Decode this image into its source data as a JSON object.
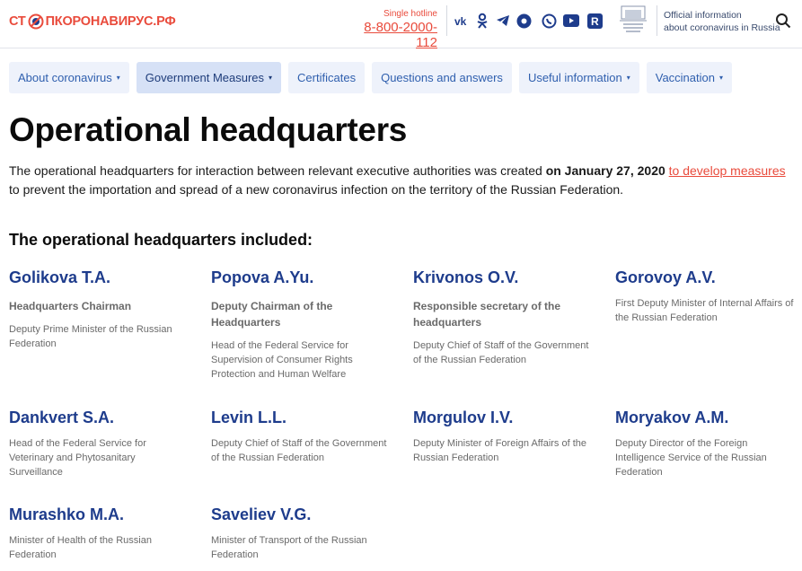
{
  "header": {
    "logo": {
      "part1": "СТ",
      "part2": "ПКОРОНАВИРУС.РФ"
    },
    "hotline_caption": "Single hotline",
    "hotline_number": "8-800-2000-112",
    "official_line1": "Official information",
    "official_line2": "about coronavirus in Russia",
    "socials": [
      "vk-icon",
      "odnoklassniki-icon",
      "telegram-icon",
      "ok-dot-icon",
      "viber-icon",
      "youtube-icon",
      "rutube-icon"
    ]
  },
  "nav": {
    "tabs": [
      {
        "label": "About coronavirus",
        "caret": "▾"
      },
      {
        "label": "Government Measures",
        "caret": "▾"
      },
      {
        "label": "Certificates",
        "caret": ""
      },
      {
        "label": "Questions and answers",
        "caret": ""
      },
      {
        "label": "Useful information",
        "caret": "▾"
      },
      {
        "label": "Vaccination",
        "caret": "▾"
      }
    ]
  },
  "page": {
    "title": "Operational headquarters",
    "intro_before": "The operational headquarters for interaction between relevant executive authorities was created ",
    "intro_date": "on January 27, 2020",
    "intro_link": "to develop measures",
    "intro_after": " to prevent the importation and spread of a new coronavirus infection on the territory of the Russian Federation.",
    "members_heading": "The operational headquarters included:"
  },
  "members": [
    {
      "name": "Golikova T.A.",
      "role": "Headquarters Chairman",
      "desc": "Deputy Prime Minister of the Russian Federation"
    },
    {
      "name": "Popova A.Yu.",
      "role": "Deputy Chairman of the Headquarters",
      "desc": "Head of the Federal Service for Supervision of Consumer Rights Protection and Human Welfare"
    },
    {
      "name": "Krivonos O.V.",
      "role": "Responsible secretary of the headquarters",
      "desc": "Deputy Chief of Staff of the Government of the Russian Federation"
    },
    {
      "name": "Gorovoy A.V.",
      "role": "",
      "desc": "First Deputy Minister of Internal Affairs of the Russian Federation"
    },
    {
      "name": "Dankvert S.A.",
      "role": "",
      "desc": "Head of the Federal Service for Veterinary and Phytosanitary Surveillance"
    },
    {
      "name": "Levin L.L.",
      "role": "",
      "desc": "Deputy Chief of Staff of the Government of the Russian Federation"
    },
    {
      "name": "Morgulov I.V.",
      "role": "",
      "desc": "Deputy Minister of Foreign Affairs of the Russian Federation"
    },
    {
      "name": "Moryakov A.M.",
      "role": "",
      "desc": "Deputy Director of the Foreign Intelligence Service of the Russian Federation"
    },
    {
      "name": "Murashko M.A.",
      "role": "",
      "desc": "Minister of Health of the Russian Federation"
    },
    {
      "name": "Saveliev V.G.",
      "role": "",
      "desc": "Minister of Transport of the Russian Federation"
    }
  ],
  "colors": {
    "accent_red": "#e94b3c",
    "brand_blue": "#1e3c8c",
    "tab_bg": "#eef2fb"
  }
}
